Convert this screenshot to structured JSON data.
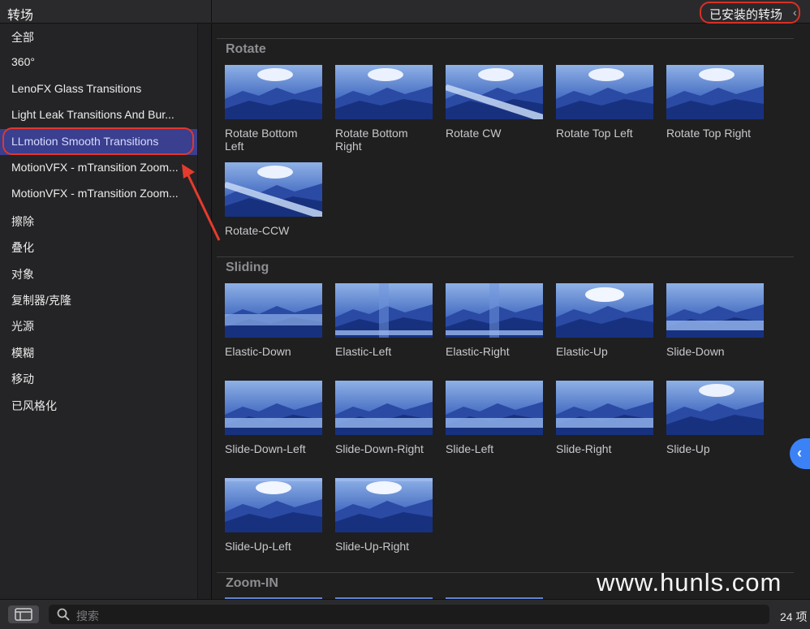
{
  "header": {
    "title": "转场",
    "installed_label": "已安装的转场",
    "installed_chevron": "‹"
  },
  "sidebar": {
    "items": [
      {
        "label": "全部"
      },
      {
        "label": "360°"
      },
      {
        "label": "LenoFX Glass Transitions"
      },
      {
        "label": "Light Leak Transitions And Bur..."
      },
      {
        "label": "LLmotion Smooth Transitions",
        "selected": true
      },
      {
        "label": "MotionVFX - mTransition Zoom..."
      },
      {
        "label": "MotionVFX - mTransition Zoom..."
      },
      {
        "label": "擦除"
      },
      {
        "label": "叠化"
      },
      {
        "label": "对象"
      },
      {
        "label": "复制器/克隆"
      },
      {
        "label": "光源"
      },
      {
        "label": "模糊"
      },
      {
        "label": "移动"
      },
      {
        "label": "已风格化"
      }
    ]
  },
  "sections": [
    {
      "title": "Rotate",
      "items": [
        {
          "name_lines": [
            "Rotate Bottom",
            "Left"
          ],
          "style": "rotate"
        },
        {
          "name_lines": [
            "Rotate Bottom",
            "Right"
          ],
          "style": "rotate"
        },
        {
          "name_lines": [
            "Rotate CW"
          ],
          "style": "rotate-stripe"
        },
        {
          "name_lines": [
            "Rotate Top Left"
          ],
          "style": "rotate"
        },
        {
          "name_lines": [
            "Rotate Top Right"
          ],
          "style": "rotate"
        },
        {
          "name_lines": [
            "Rotate-CCW"
          ],
          "style": "rotate-stripe"
        }
      ]
    },
    {
      "title": "Sliding",
      "items": [
        {
          "name_lines": [
            "Elastic-Down"
          ],
          "style": "elastic-h"
        },
        {
          "name_lines": [
            "Elastic-Left"
          ],
          "style": "elastic-v"
        },
        {
          "name_lines": [
            "Elastic-Right"
          ],
          "style": "elastic-v"
        },
        {
          "name_lines": [
            "Elastic-Up"
          ],
          "style": "elastic-up"
        },
        {
          "name_lines": [
            "Slide-Down"
          ],
          "style": "slide"
        },
        {
          "name_lines": [
            "Slide-Down-Left"
          ],
          "style": "slide"
        },
        {
          "name_lines": [
            "Slide-Down-Right"
          ],
          "style": "slide"
        },
        {
          "name_lines": [
            "Slide-Left"
          ],
          "style": "slide"
        },
        {
          "name_lines": [
            "Slide-Right"
          ],
          "style": "slide"
        },
        {
          "name_lines": [
            "Slide-Up"
          ],
          "style": "rotate"
        },
        {
          "name_lines": [
            "Slide-Up-Left"
          ],
          "style": "slide-up"
        },
        {
          "name_lines": [
            "Slide-Up-Right"
          ],
          "style": "slide-up"
        }
      ]
    },
    {
      "title": "Zoom-IN",
      "items": []
    }
  ],
  "footer": {
    "search_placeholder": "搜索",
    "count_label": "24 项"
  },
  "side_tab": {
    "glyph": "‹"
  },
  "watermark": "www.hunls.com",
  "colors": {
    "accent_blue": "#3b82f6",
    "selection": "#3a3f8f",
    "highlight_red": "#d93025"
  },
  "icons": [
    "sidebar-toggle-icon",
    "search-icon",
    "chevron-left-icon",
    "arrow-annotation-icon"
  ]
}
